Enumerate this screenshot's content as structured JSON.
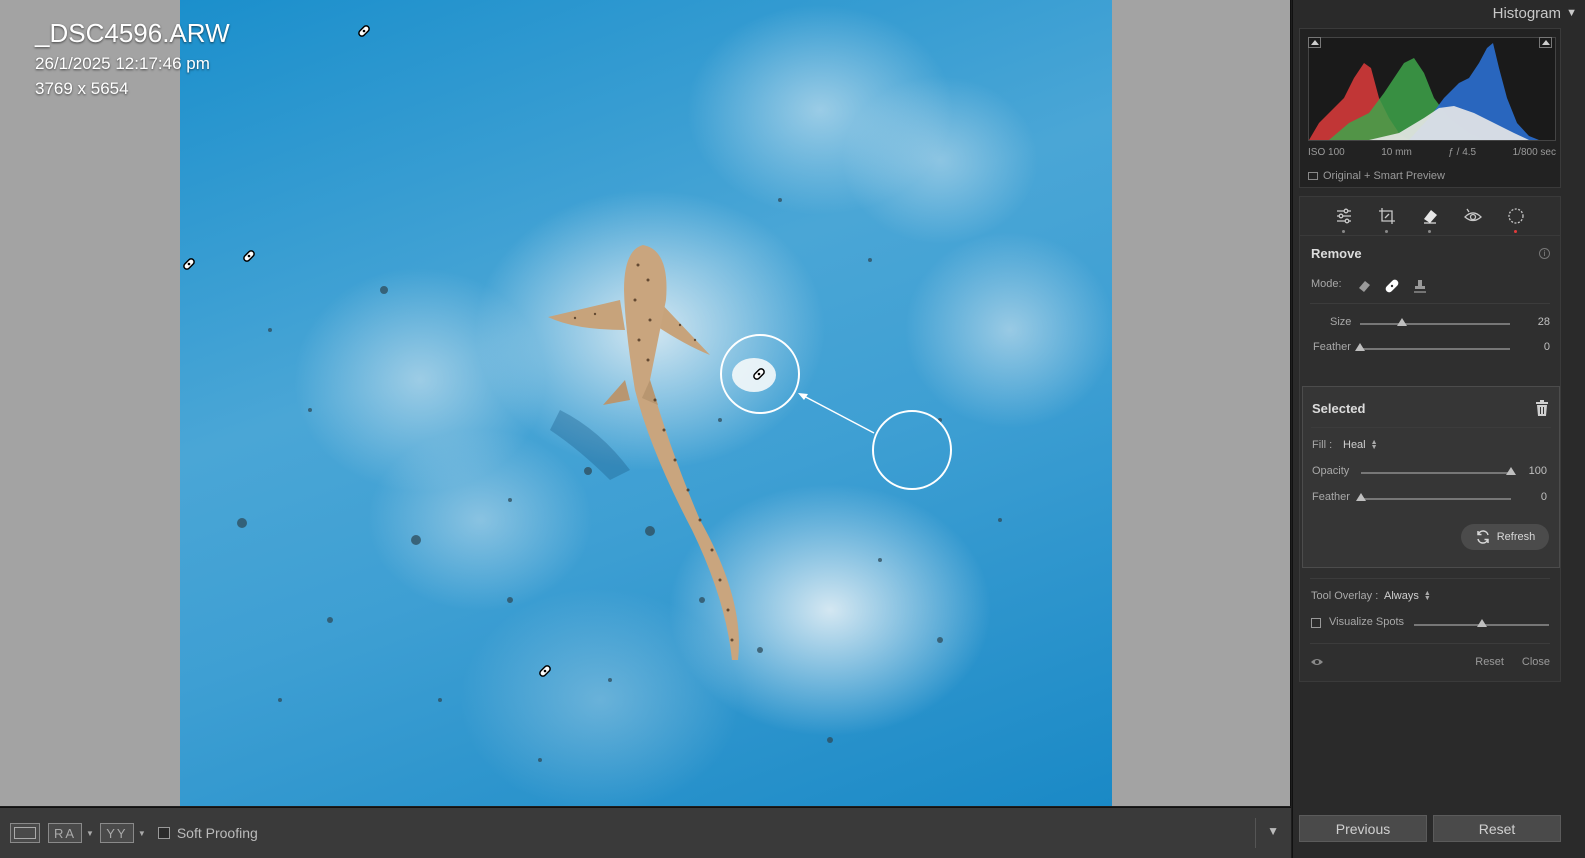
{
  "photo": {
    "file_name": "_DSC4596.ARW",
    "date_time": "26/1/2025 12:17:46 pm",
    "dimensions": "3769 x 5654"
  },
  "toolbar": {
    "view_compare_label": "RA",
    "view_survey_label": "YY",
    "soft_proofing_label": "Soft Proofing",
    "soft_proofing_checked": false
  },
  "histogram": {
    "title": "Histogram",
    "iso": "ISO 100",
    "focal_length": "10 mm",
    "aperture": "ƒ / 4.5",
    "shutter": "1/800 sec",
    "preview_status": "Original + Smart Preview"
  },
  "tools": [
    {
      "name": "edit-sliders-icon",
      "active": false
    },
    {
      "name": "crop-icon",
      "active": false
    },
    {
      "name": "remove-eraser-icon",
      "active": true
    },
    {
      "name": "red-eye-icon",
      "active": false
    },
    {
      "name": "masking-icon",
      "active": false
    }
  ],
  "remove": {
    "title": "Remove",
    "mode_label": "Mode:",
    "size_label": "Size",
    "size_value": "28",
    "size_fraction": 0.28,
    "feather_label": "Feather",
    "feather_value": "0",
    "feather_fraction": 0
  },
  "selected": {
    "title": "Selected",
    "fill_label": "Fill :",
    "fill_value": "Heal",
    "opacity_label": "Opacity",
    "opacity_value": "100",
    "opacity_fraction": 1,
    "feather_label": "Feather",
    "feather_value": "0",
    "feather_fraction": 0,
    "refresh_label": "Refresh"
  },
  "overlay": {
    "tool_overlay_label": "Tool Overlay :",
    "tool_overlay_value": "Always",
    "visualize_spots_label": "Visualize Spots",
    "visualize_spots_checked": false,
    "visualize_spots_fraction": 0.5
  },
  "footer": {
    "reset_label": "Reset",
    "close_label": "Close"
  },
  "nav": {
    "previous_label": "Previous",
    "reset_label": "Reset"
  },
  "colors": {
    "accent_red": "#e23b3b",
    "panel_bg": "#2a2a2a",
    "canvas_bg": "#a3a3a3"
  }
}
